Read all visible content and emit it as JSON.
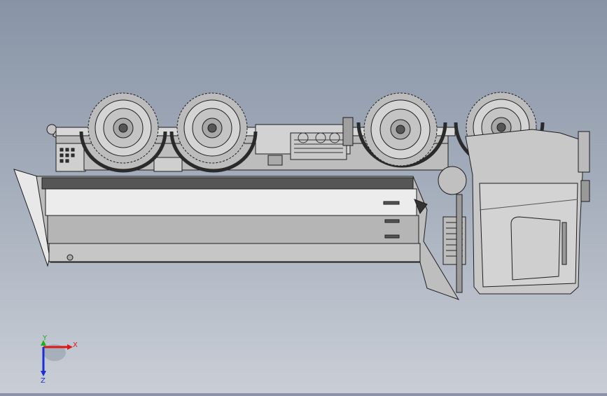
{
  "viewport": {
    "model_name": "truck-crane-upside-down",
    "colors": {
      "background_top": "#8894a6",
      "background_bottom": "#c9ced6",
      "body_fill": "#c4c4c4",
      "edge": "#1e1e1e",
      "light_panel": "#ececec"
    }
  },
  "triad": {
    "x_label": "X",
    "y_label": "Y",
    "z_label": "Z",
    "x_color": "#d81a1a",
    "y_color": "#19b319",
    "z_color": "#1a2fd8"
  },
  "wheels": {
    "count": 4
  }
}
